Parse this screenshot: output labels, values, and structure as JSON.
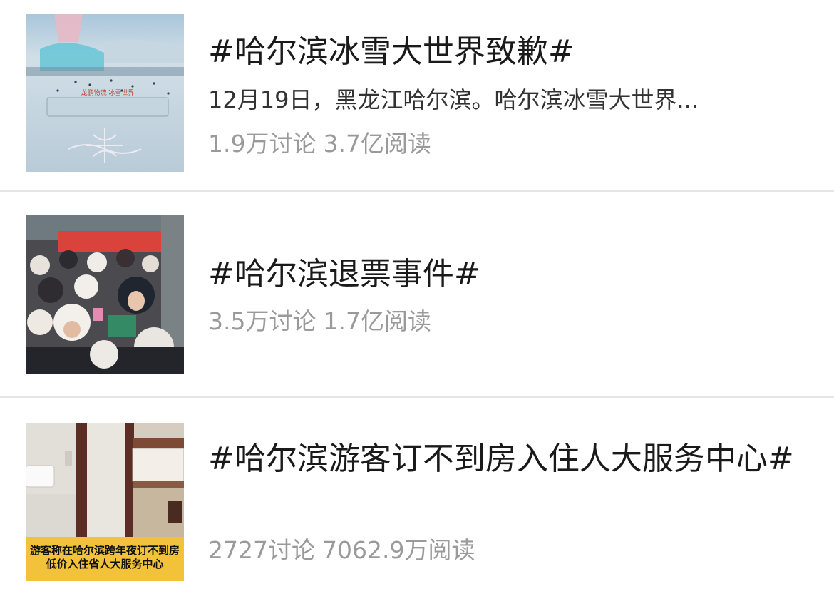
{
  "topics": [
    {
      "title": "#哈尔滨冰雪大世界致歉#",
      "description": "12月19日，黑龙江哈尔滨。哈尔滨冰雪大世界...",
      "discussions": "1.9万讨论",
      "reads": "3.7亿阅读",
      "thumbnail_overlay": [
        "龙鹏物流 冰雪世界"
      ]
    },
    {
      "title": "#哈尔滨退票事件#",
      "discussions": "3.5万讨论",
      "reads": "1.7亿阅读"
    },
    {
      "title": "#哈尔滨游客订不到房入住人大服务中心#",
      "discussions": "2727讨论",
      "reads": "7062.9万阅读",
      "thumbnail_caption": [
        "游客称在哈尔滨跨年夜订不到房",
        "低价入住省人大服务中心"
      ]
    }
  ]
}
